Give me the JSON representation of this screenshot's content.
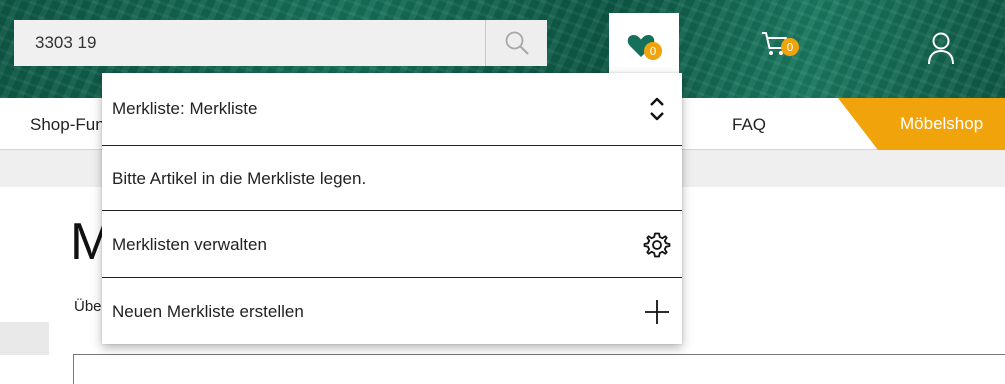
{
  "search": {
    "value": "3303 19"
  },
  "header": {
    "wishlist_count": "0",
    "cart_count": "0"
  },
  "nav": {
    "shop_fun_label": "Shop-Fun",
    "faq_label": "FAQ",
    "moebelshop_label": "Möbelshop"
  },
  "page": {
    "title_partial": "M",
    "intro_partial": "Übe"
  },
  "wishlist_dropdown": {
    "selector_label": "Merkliste: Merkliste",
    "empty_message": "Bitte Artikel in die Merkliste legen.",
    "manage_label": "Merklisten verwalten",
    "create_label": "Neuen Merkliste erstellen"
  },
  "colors": {
    "header_green": "#15705a",
    "accent_orange": "#f0a30a"
  },
  "icons": [
    "search-icon",
    "heart-icon",
    "cart-icon",
    "user-icon",
    "chevron-up-down-icon",
    "gear-icon",
    "plus-icon"
  ]
}
